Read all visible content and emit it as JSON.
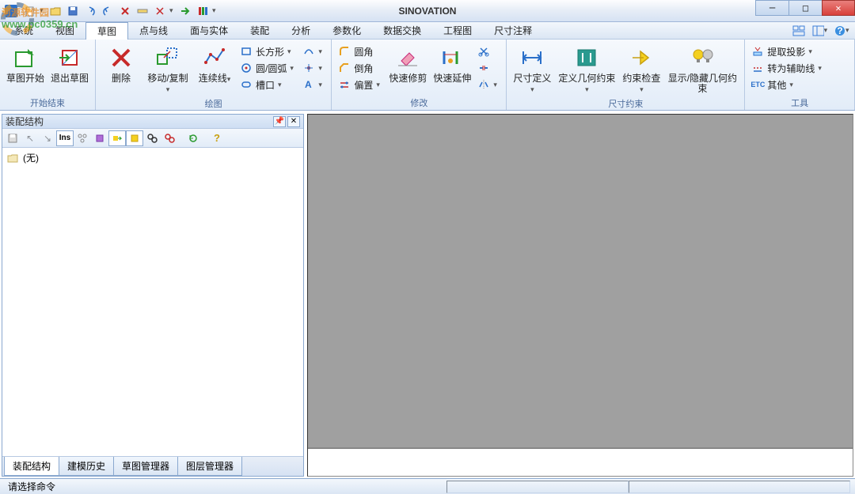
{
  "window": {
    "title": "SINOVATION"
  },
  "watermark": {
    "line1": "河源软件园",
    "line2": "www.pc0359.cn"
  },
  "menu": {
    "items": [
      "系统",
      "视图",
      "草图",
      "点与线",
      "面与实体",
      "装配",
      "分析",
      "参数化",
      "数据交换",
      "工程图",
      "尺寸注释"
    ],
    "active_index": 2
  },
  "ribbon": {
    "groups": [
      {
        "label": "开始结束",
        "buttons": [
          {
            "name": "sketch-start",
            "label": "草图开始"
          },
          {
            "name": "sketch-exit",
            "label": "退出草图"
          }
        ]
      },
      {
        "label": "绘图",
        "buttons": [
          {
            "name": "delete",
            "label": "删除"
          },
          {
            "name": "move-copy",
            "label": "移动/复制"
          },
          {
            "name": "polyline",
            "label": "连续线"
          }
        ],
        "small": [
          {
            "name": "rect",
            "label": "长方形"
          },
          {
            "name": "circle-arc",
            "label": "圆/圆弧"
          },
          {
            "name": "slot",
            "label": "槽口"
          }
        ]
      },
      {
        "label": "修改",
        "buttons": [
          {
            "name": "quick-trim",
            "label": "快速修剪"
          },
          {
            "name": "quick-extend",
            "label": "快速延伸"
          }
        ],
        "small": [
          {
            "name": "fillet",
            "label": "圆角"
          },
          {
            "name": "chamfer",
            "label": "倒角"
          },
          {
            "name": "offset",
            "label": "偏置"
          }
        ]
      },
      {
        "label": "尺寸约束",
        "buttons": [
          {
            "name": "dim-define",
            "label": "尺寸定义"
          },
          {
            "name": "geo-constraint",
            "label": "定义几何约束"
          },
          {
            "name": "constraint-check",
            "label": "约束检查"
          },
          {
            "name": "show-hide-constraint",
            "label": "显示/隐藏几何约束"
          }
        ]
      },
      {
        "label": "工具",
        "small": [
          {
            "name": "extract-proj",
            "label": "提取投影"
          },
          {
            "name": "to-construction",
            "label": "转为辅助线"
          },
          {
            "name": "etc",
            "label": "其他"
          }
        ]
      }
    ]
  },
  "dock": {
    "title": "装配结构",
    "tree_root": "(无)",
    "toolbar_ins": "Ins",
    "tabs": [
      "装配结构",
      "建模历史",
      "草图管理器",
      "图层管理器"
    ],
    "active_tab": 0
  },
  "status": {
    "message": "请选择命令"
  }
}
